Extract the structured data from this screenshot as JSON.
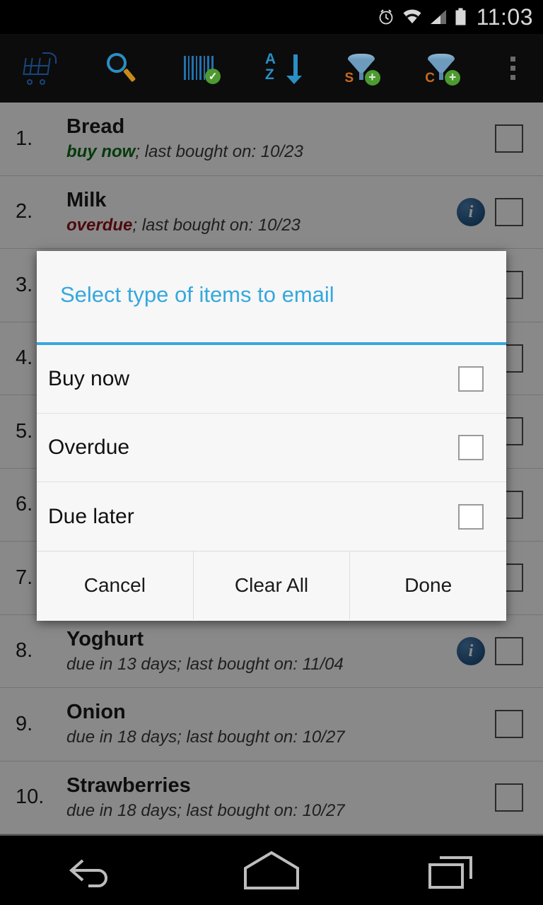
{
  "status_bar": {
    "time": "11:03",
    "icons": [
      "alarm-clock-icon",
      "wifi-icon",
      "cellular-signal-icon",
      "battery-icon"
    ]
  },
  "action_bar": {
    "buttons": [
      {
        "name": "shopping-cart-icon",
        "label": "Shopping cart"
      },
      {
        "name": "search-icon",
        "label": "Search"
      },
      {
        "name": "barcode-scan-icon",
        "label": "Scan barcode"
      },
      {
        "name": "sort-az-icon",
        "label": "Sort A-Z"
      },
      {
        "name": "filter-store-add-icon",
        "label": "S",
        "letter": "S"
      },
      {
        "name": "filter-category-add-icon",
        "label": "C",
        "letter": "C"
      },
      {
        "name": "overflow-menu-icon",
        "label": "More options"
      }
    ]
  },
  "list": {
    "items": [
      {
        "index": "1.",
        "title": "Bread",
        "status": "buy now",
        "status_type": "buynow",
        "detail": "; last bought on: 10/23",
        "has_info": false,
        "checked": false
      },
      {
        "index": "2.",
        "title": "Milk",
        "status": "overdue",
        "status_type": "overdue",
        "detail": "; last bought on: 10/23",
        "has_info": true,
        "checked": false
      },
      {
        "index": "3.",
        "title": "",
        "status": "",
        "status_type": "none",
        "detail": "",
        "has_info": false,
        "checked": false
      },
      {
        "index": "4.",
        "title": "",
        "status": "",
        "status_type": "none",
        "detail": "",
        "has_info": false,
        "checked": false
      },
      {
        "index": "5.",
        "title": "",
        "status": "",
        "status_type": "none",
        "detail": "",
        "has_info": false,
        "checked": false
      },
      {
        "index": "6.",
        "title": "",
        "status": "",
        "status_type": "none",
        "detail": "",
        "has_info": false,
        "checked": false
      },
      {
        "index": "7.",
        "title": "",
        "status": "",
        "status_type": "none",
        "detail": "",
        "has_info": false,
        "checked": false
      },
      {
        "index": "8.",
        "title": "Yoghurt",
        "status": "",
        "status_type": "none",
        "detail": "due in 13 days; last bought on: 11/04",
        "has_info": true,
        "checked": false
      },
      {
        "index": "9.",
        "title": "Onion",
        "status": "",
        "status_type": "none",
        "detail": "due in 18 days; last bought on: 10/27",
        "has_info": false,
        "checked": false
      },
      {
        "index": "10.",
        "title": "Strawberries",
        "status": "",
        "status_type": "none",
        "detail": "due in 18 days; last bought on: 10/27",
        "has_info": false,
        "checked": false
      }
    ]
  },
  "dialog": {
    "title": "Select type of items to email",
    "accent_color": "#35a8dd",
    "options": [
      {
        "label": "Buy now",
        "checked": false
      },
      {
        "label": "Overdue",
        "checked": false
      },
      {
        "label": "Due later",
        "checked": false
      }
    ],
    "buttons": [
      {
        "label": "Cancel",
        "name": "cancel-button"
      },
      {
        "label": "Clear All",
        "name": "clear-all-button"
      },
      {
        "label": "Done",
        "name": "done-button"
      }
    ]
  },
  "nav_bar": {
    "buttons": [
      {
        "name": "back-icon",
        "label": "Back"
      },
      {
        "name": "home-icon",
        "label": "Home"
      },
      {
        "name": "recents-icon",
        "label": "Recent apps"
      }
    ]
  }
}
